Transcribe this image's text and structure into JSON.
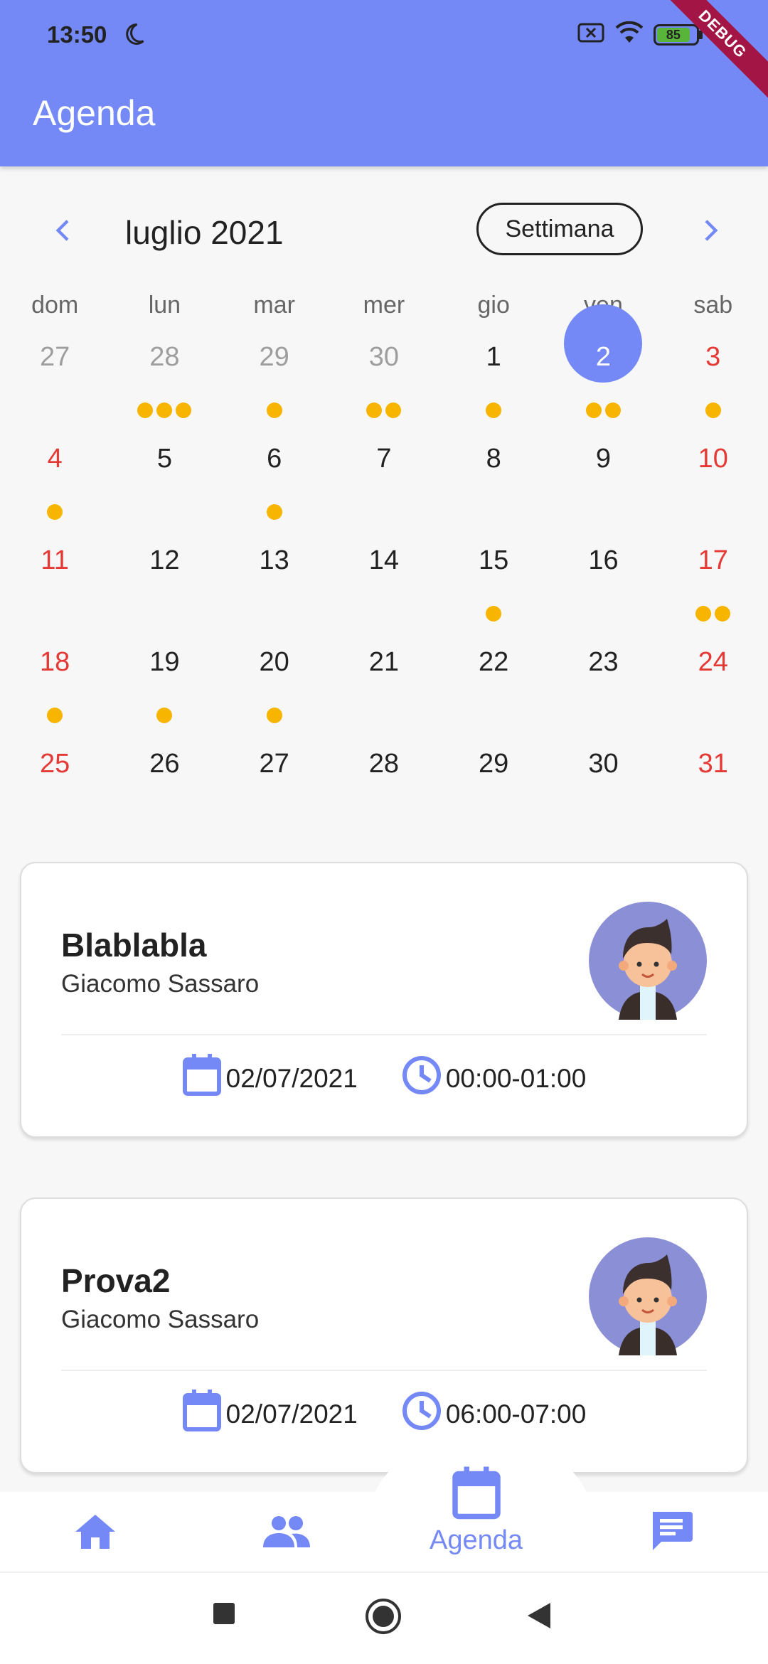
{
  "status_bar": {
    "time": "13:50",
    "battery": "85",
    "debug_label": "DEBUG"
  },
  "app_bar": {
    "title": "Agenda"
  },
  "calendar": {
    "month_label": "luglio 2021",
    "view_toggle": "Settimana",
    "weekdays": [
      "dom",
      "lun",
      "mar",
      "mer",
      "gio",
      "ven",
      "sab"
    ],
    "weeks": [
      [
        {
          "n": "27",
          "out": true,
          "dots": 0
        },
        {
          "n": "28",
          "out": true,
          "dots": 3
        },
        {
          "n": "29",
          "out": true,
          "dots": 1
        },
        {
          "n": "30",
          "out": true,
          "dots": 2
        },
        {
          "n": "1",
          "dots": 1
        },
        {
          "n": "2",
          "dots": 2,
          "selected": true
        },
        {
          "n": "3",
          "dots": 1,
          "weekend": true
        }
      ],
      [
        {
          "n": "4",
          "dots": 1,
          "weekend": true
        },
        {
          "n": "5",
          "dots": 0
        },
        {
          "n": "6",
          "dots": 1
        },
        {
          "n": "7",
          "dots": 0
        },
        {
          "n": "8",
          "dots": 0
        },
        {
          "n": "9",
          "dots": 0
        },
        {
          "n": "10",
          "dots": 0,
          "weekend": true
        }
      ],
      [
        {
          "n": "11",
          "dots": 0,
          "weekend": true
        },
        {
          "n": "12",
          "dots": 0
        },
        {
          "n": "13",
          "dots": 0
        },
        {
          "n": "14",
          "dots": 0
        },
        {
          "n": "15",
          "dots": 1
        },
        {
          "n": "16",
          "dots": 0
        },
        {
          "n": "17",
          "dots": 2,
          "weekend": true
        }
      ],
      [
        {
          "n": "18",
          "dots": 1,
          "weekend": true
        },
        {
          "n": "19",
          "dots": 1
        },
        {
          "n": "20",
          "dots": 1
        },
        {
          "n": "21",
          "dots": 0
        },
        {
          "n": "22",
          "dots": 0
        },
        {
          "n": "23",
          "dots": 0
        },
        {
          "n": "24",
          "dots": 0,
          "weekend": true
        }
      ],
      [
        {
          "n": "25",
          "dots": 0,
          "weekend": true
        },
        {
          "n": "26",
          "dots": 0
        },
        {
          "n": "27",
          "dots": 0
        },
        {
          "n": "28",
          "dots": 0
        },
        {
          "n": "29",
          "dots": 0
        },
        {
          "n": "30",
          "dots": 0
        },
        {
          "n": "31",
          "dots": 0,
          "weekend": true
        }
      ]
    ]
  },
  "events": [
    {
      "title": "Blablabla",
      "organizer": "Giacomo Sassaro",
      "date": "02/07/2021",
      "time": "00:00-01:00"
    },
    {
      "title": "Prova2",
      "organizer": "Giacomo Sassaro",
      "date": "02/07/2021",
      "time": "06:00-07:00"
    }
  ],
  "bottom_nav": {
    "agenda_label": "Agenda"
  },
  "colors": {
    "primary": "#7489f5",
    "weekend": "#e53935",
    "event_dot": "#f7b500"
  }
}
